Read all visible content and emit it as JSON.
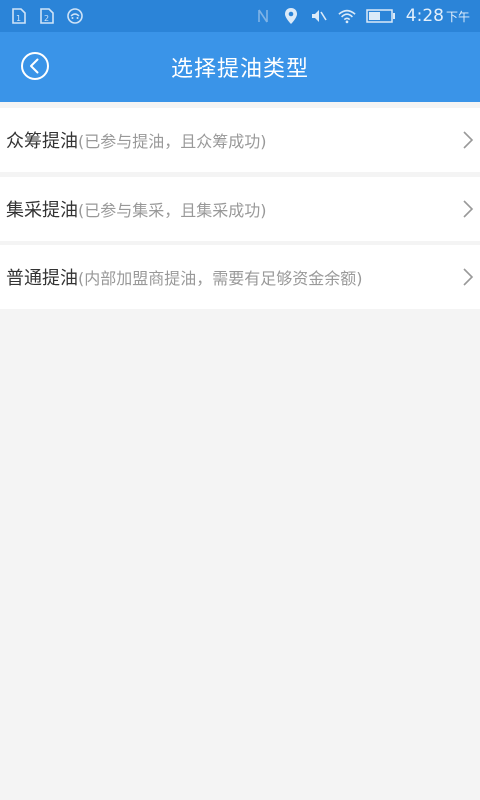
{
  "status_bar": {
    "time": "4:28",
    "ampm": "下午",
    "left_icons": [
      "sim-card-1-icon",
      "sim-card-2-icon",
      "notification-icon"
    ],
    "right_icons": [
      "nfc-icon",
      "location-icon",
      "mute-icon",
      "wifi-icon",
      "battery-icon"
    ]
  },
  "header": {
    "title": "选择提油类型",
    "back_icon": "back-circle-icon"
  },
  "options": [
    {
      "title": "众筹提油",
      "note": "(已参与提油，且众筹成功)"
    },
    {
      "title": "集采提油",
      "note": "(已参与集采，且集采成功)"
    },
    {
      "title": "普通提油",
      "note": "(内部加盟商提油，需要有足够资金余额)"
    }
  ],
  "colors": {
    "status_bar_bg": "#2b84d8",
    "header_bg": "#3a94e8",
    "page_bg": "#f4f4f4",
    "row_bg": "#ffffff",
    "title_text": "#333333",
    "note_text": "#999999"
  }
}
